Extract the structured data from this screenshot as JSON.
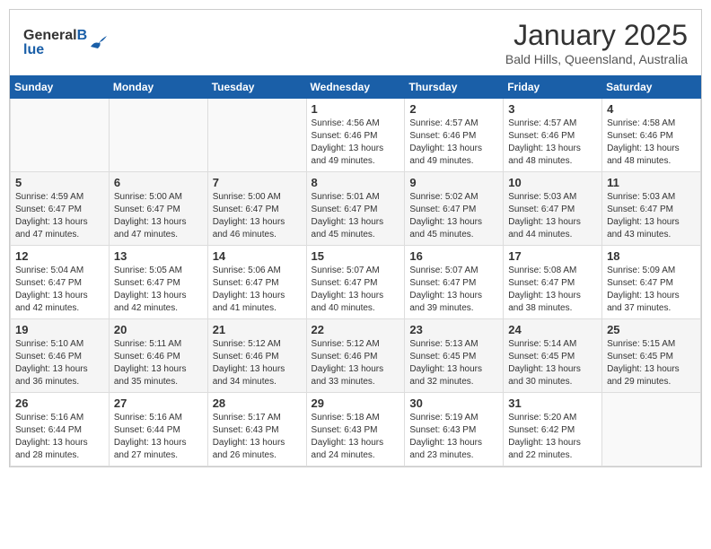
{
  "header": {
    "logo_general": "General",
    "logo_blue": "Blue",
    "month_title": "January 2025",
    "subtitle": "Bald Hills, Queensland, Australia"
  },
  "days_of_week": [
    "Sunday",
    "Monday",
    "Tuesday",
    "Wednesday",
    "Thursday",
    "Friday",
    "Saturday"
  ],
  "weeks": [
    {
      "days": [
        {
          "number": "",
          "sunrise": "",
          "sunset": "",
          "daylight": ""
        },
        {
          "number": "",
          "sunrise": "",
          "sunset": "",
          "daylight": ""
        },
        {
          "number": "",
          "sunrise": "",
          "sunset": "",
          "daylight": ""
        },
        {
          "number": "1",
          "sunrise": "Sunrise: 4:56 AM",
          "sunset": "Sunset: 6:46 PM",
          "daylight": "Daylight: 13 hours and 49 minutes."
        },
        {
          "number": "2",
          "sunrise": "Sunrise: 4:57 AM",
          "sunset": "Sunset: 6:46 PM",
          "daylight": "Daylight: 13 hours and 49 minutes."
        },
        {
          "number": "3",
          "sunrise": "Sunrise: 4:57 AM",
          "sunset": "Sunset: 6:46 PM",
          "daylight": "Daylight: 13 hours and 48 minutes."
        },
        {
          "number": "4",
          "sunrise": "Sunrise: 4:58 AM",
          "sunset": "Sunset: 6:46 PM",
          "daylight": "Daylight: 13 hours and 48 minutes."
        }
      ]
    },
    {
      "days": [
        {
          "number": "5",
          "sunrise": "Sunrise: 4:59 AM",
          "sunset": "Sunset: 6:47 PM",
          "daylight": "Daylight: 13 hours and 47 minutes."
        },
        {
          "number": "6",
          "sunrise": "Sunrise: 5:00 AM",
          "sunset": "Sunset: 6:47 PM",
          "daylight": "Daylight: 13 hours and 47 minutes."
        },
        {
          "number": "7",
          "sunrise": "Sunrise: 5:00 AM",
          "sunset": "Sunset: 6:47 PM",
          "daylight": "Daylight: 13 hours and 46 minutes."
        },
        {
          "number": "8",
          "sunrise": "Sunrise: 5:01 AM",
          "sunset": "Sunset: 6:47 PM",
          "daylight": "Daylight: 13 hours and 45 minutes."
        },
        {
          "number": "9",
          "sunrise": "Sunrise: 5:02 AM",
          "sunset": "Sunset: 6:47 PM",
          "daylight": "Daylight: 13 hours and 45 minutes."
        },
        {
          "number": "10",
          "sunrise": "Sunrise: 5:03 AM",
          "sunset": "Sunset: 6:47 PM",
          "daylight": "Daylight: 13 hours and 44 minutes."
        },
        {
          "number": "11",
          "sunrise": "Sunrise: 5:03 AM",
          "sunset": "Sunset: 6:47 PM",
          "daylight": "Daylight: 13 hours and 43 minutes."
        }
      ]
    },
    {
      "days": [
        {
          "number": "12",
          "sunrise": "Sunrise: 5:04 AM",
          "sunset": "Sunset: 6:47 PM",
          "daylight": "Daylight: 13 hours and 42 minutes."
        },
        {
          "number": "13",
          "sunrise": "Sunrise: 5:05 AM",
          "sunset": "Sunset: 6:47 PM",
          "daylight": "Daylight: 13 hours and 42 minutes."
        },
        {
          "number": "14",
          "sunrise": "Sunrise: 5:06 AM",
          "sunset": "Sunset: 6:47 PM",
          "daylight": "Daylight: 13 hours and 41 minutes."
        },
        {
          "number": "15",
          "sunrise": "Sunrise: 5:07 AM",
          "sunset": "Sunset: 6:47 PM",
          "daylight": "Daylight: 13 hours and 40 minutes."
        },
        {
          "number": "16",
          "sunrise": "Sunrise: 5:07 AM",
          "sunset": "Sunset: 6:47 PM",
          "daylight": "Daylight: 13 hours and 39 minutes."
        },
        {
          "number": "17",
          "sunrise": "Sunrise: 5:08 AM",
          "sunset": "Sunset: 6:47 PM",
          "daylight": "Daylight: 13 hours and 38 minutes."
        },
        {
          "number": "18",
          "sunrise": "Sunrise: 5:09 AM",
          "sunset": "Sunset: 6:47 PM",
          "daylight": "Daylight: 13 hours and 37 minutes."
        }
      ]
    },
    {
      "days": [
        {
          "number": "19",
          "sunrise": "Sunrise: 5:10 AM",
          "sunset": "Sunset: 6:46 PM",
          "daylight": "Daylight: 13 hours and 36 minutes."
        },
        {
          "number": "20",
          "sunrise": "Sunrise: 5:11 AM",
          "sunset": "Sunset: 6:46 PM",
          "daylight": "Daylight: 13 hours and 35 minutes."
        },
        {
          "number": "21",
          "sunrise": "Sunrise: 5:12 AM",
          "sunset": "Sunset: 6:46 PM",
          "daylight": "Daylight: 13 hours and 34 minutes."
        },
        {
          "number": "22",
          "sunrise": "Sunrise: 5:12 AM",
          "sunset": "Sunset: 6:46 PM",
          "daylight": "Daylight: 13 hours and 33 minutes."
        },
        {
          "number": "23",
          "sunrise": "Sunrise: 5:13 AM",
          "sunset": "Sunset: 6:45 PM",
          "daylight": "Daylight: 13 hours and 32 minutes."
        },
        {
          "number": "24",
          "sunrise": "Sunrise: 5:14 AM",
          "sunset": "Sunset: 6:45 PM",
          "daylight": "Daylight: 13 hours and 30 minutes."
        },
        {
          "number": "25",
          "sunrise": "Sunrise: 5:15 AM",
          "sunset": "Sunset: 6:45 PM",
          "daylight": "Daylight: 13 hours and 29 minutes."
        }
      ]
    },
    {
      "days": [
        {
          "number": "26",
          "sunrise": "Sunrise: 5:16 AM",
          "sunset": "Sunset: 6:44 PM",
          "daylight": "Daylight: 13 hours and 28 minutes."
        },
        {
          "number": "27",
          "sunrise": "Sunrise: 5:16 AM",
          "sunset": "Sunset: 6:44 PM",
          "daylight": "Daylight: 13 hours and 27 minutes."
        },
        {
          "number": "28",
          "sunrise": "Sunrise: 5:17 AM",
          "sunset": "Sunset: 6:43 PM",
          "daylight": "Daylight: 13 hours and 26 minutes."
        },
        {
          "number": "29",
          "sunrise": "Sunrise: 5:18 AM",
          "sunset": "Sunset: 6:43 PM",
          "daylight": "Daylight: 13 hours and 24 minutes."
        },
        {
          "number": "30",
          "sunrise": "Sunrise: 5:19 AM",
          "sunset": "Sunset: 6:43 PM",
          "daylight": "Daylight: 13 hours and 23 minutes."
        },
        {
          "number": "31",
          "sunrise": "Sunrise: 5:20 AM",
          "sunset": "Sunset: 6:42 PM",
          "daylight": "Daylight: 13 hours and 22 minutes."
        },
        {
          "number": "",
          "sunrise": "",
          "sunset": "",
          "daylight": ""
        }
      ]
    }
  ]
}
